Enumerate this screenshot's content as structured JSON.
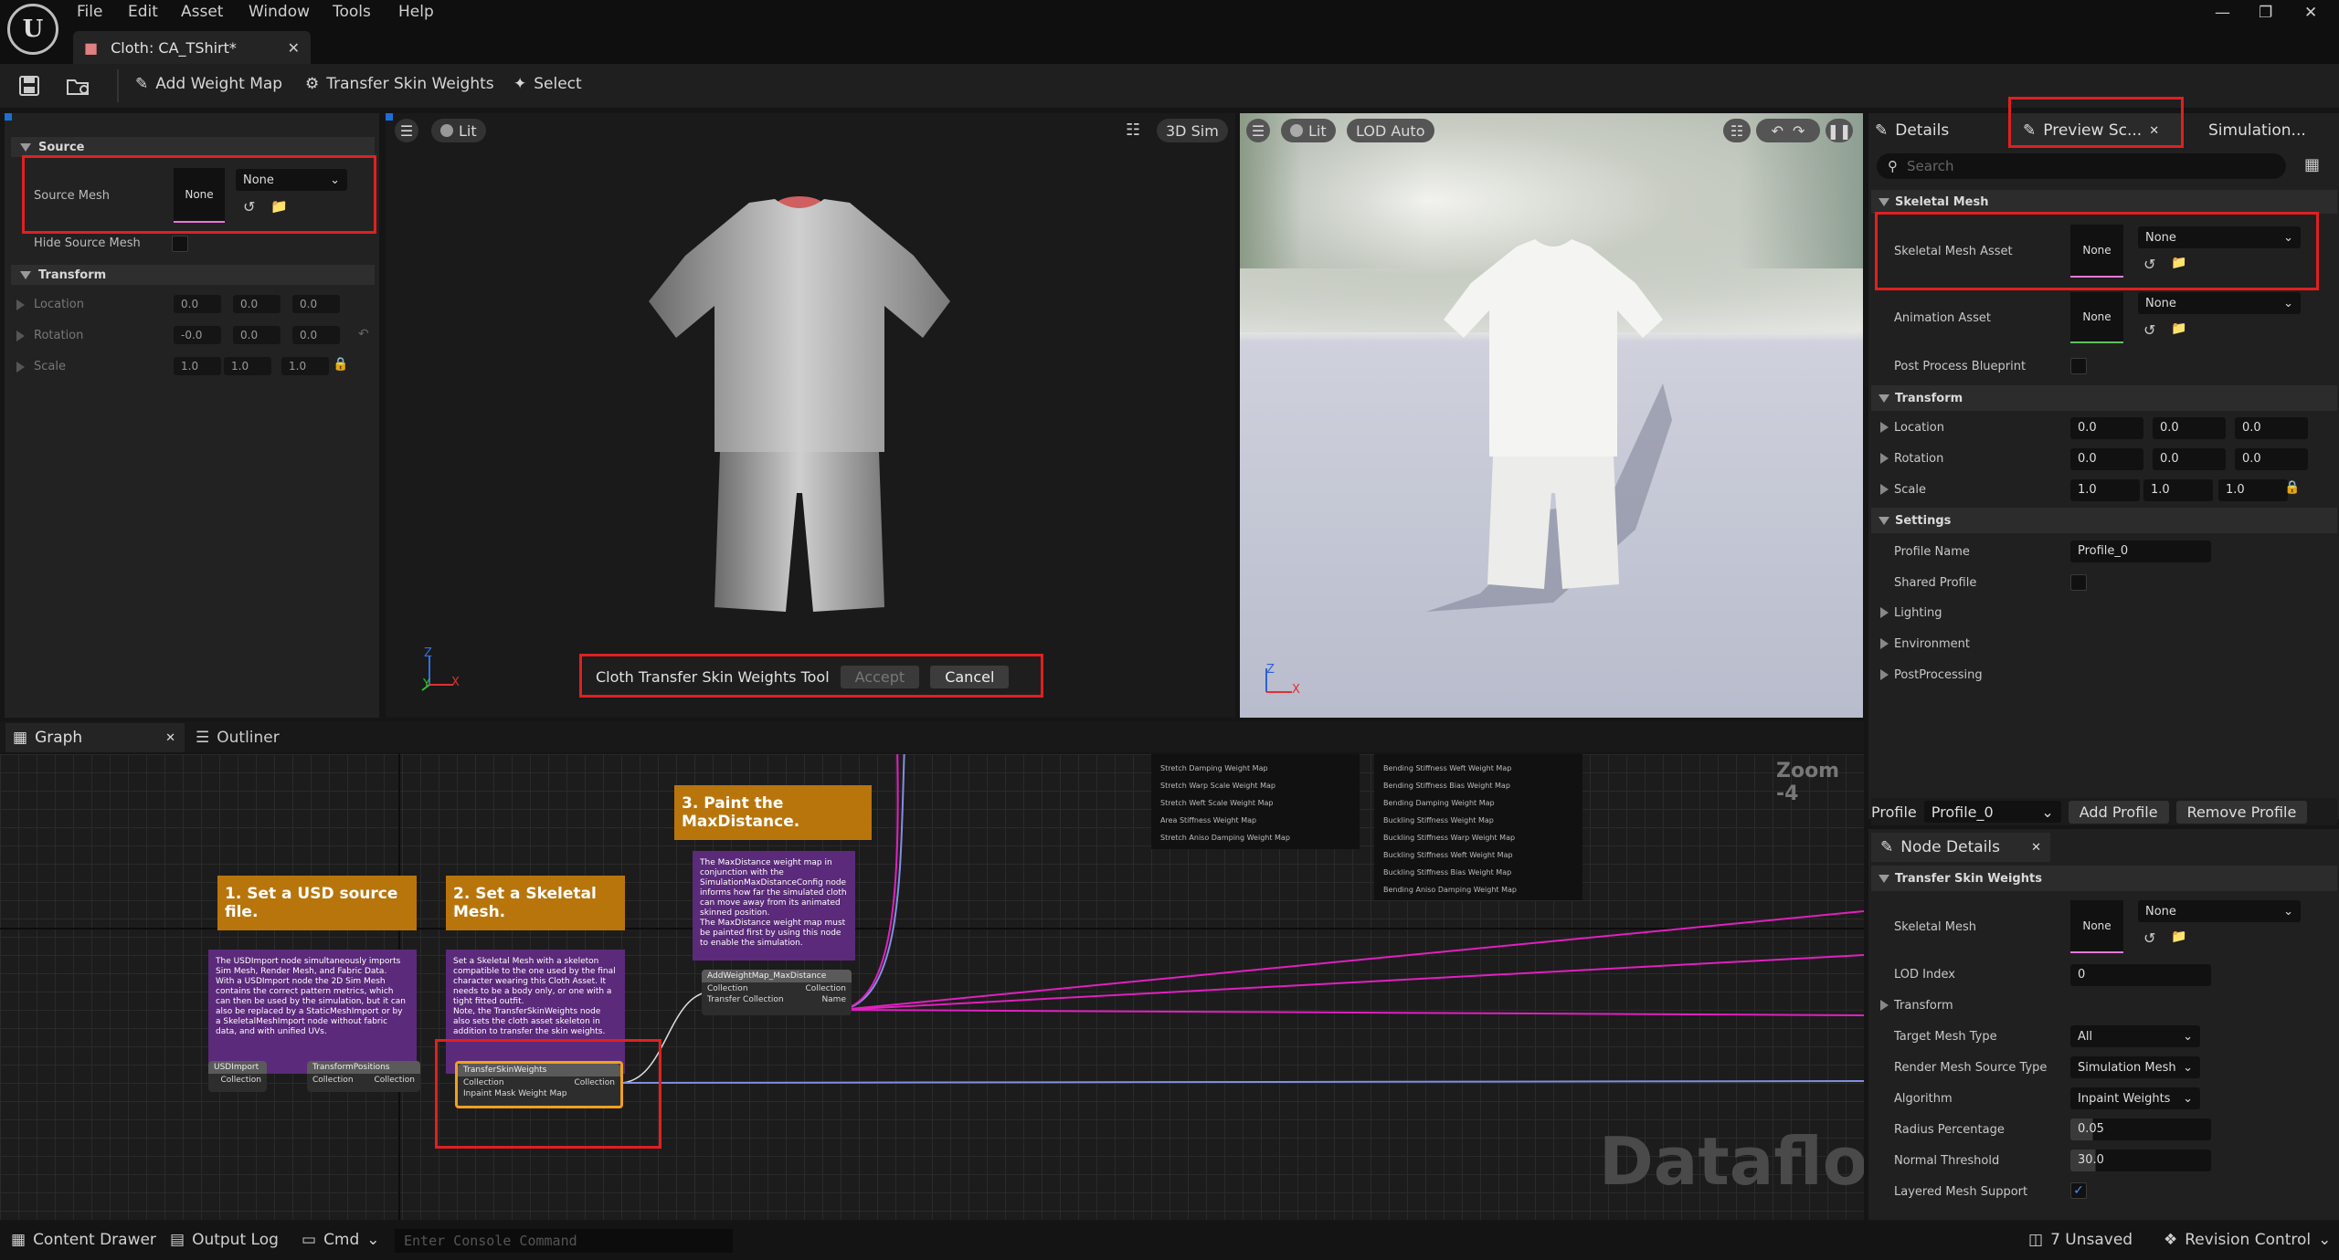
{
  "titlebar": {
    "menus": [
      "File",
      "Edit",
      "Asset",
      "Window",
      "Tools",
      "Help"
    ],
    "tab_label": "Cloth: CA_TShirt*"
  },
  "toolbar": {
    "add_weight_map": "Add Weight Map",
    "transfer_skin_weights": "Transfer Skin Weights",
    "select": "Select"
  },
  "left_panel": {
    "source_section": "Source",
    "source_mesh_label": "Source Mesh",
    "source_mesh_thumb": "None",
    "source_mesh_value": "None",
    "hide_source_mesh": "Hide Source Mesh",
    "transform_section": "Transform",
    "location_label": "Location",
    "location": [
      "0.0",
      "0.0",
      "0.0"
    ],
    "rotation_label": "Rotation",
    "rotation": [
      "-0.0",
      "0.0",
      "0.0"
    ],
    "scale_label": "Scale",
    "scale": [
      "1.0",
      "1.0",
      "1.0"
    ]
  },
  "viewport1": {
    "lit": "Lit",
    "sim": "3D Sim",
    "axis_z": "Z",
    "axis_y": "Y",
    "axis_x": "X",
    "tool_name": "Cloth Transfer Skin Weights Tool",
    "accept": "Accept",
    "cancel": "Cancel"
  },
  "viewport2": {
    "lit": "Lit",
    "lod": "LOD Auto",
    "axis_z": "Z",
    "axis_x": "X"
  },
  "right_panel": {
    "tabs": [
      "Details",
      "Preview Sc...",
      "Simulation..."
    ],
    "search_placeholder": "Search",
    "skeletal_mesh_section": "Skeletal Mesh",
    "skeletal_mesh_asset": "Skeletal Mesh Asset",
    "sk_thumb": "None",
    "sk_value": "None",
    "animation_asset": "Animation Asset",
    "anim_thumb": "None",
    "anim_value": "None",
    "post_process": "Post Process Blueprint",
    "transform_section": "Transform",
    "location_label": "Location",
    "location": [
      "0.0",
      "0.0",
      "0.0"
    ],
    "rotation_label": "Rotation",
    "rotation": [
      "0.0",
      "0.0",
      "0.0"
    ],
    "scale_label": "Scale",
    "scale": [
      "1.0",
      "1.0",
      "1.0"
    ],
    "settings_section": "Settings",
    "profile_name_label": "Profile Name",
    "profile_name": "Profile_0",
    "shared_profile": "Shared Profile",
    "lighting": "Lighting",
    "environment": "Environment",
    "postprocessing": "PostProcessing",
    "profile_label": "Profile",
    "profile_value": "Profile_0",
    "add_profile": "Add Profile",
    "remove_profile": "Remove Profile"
  },
  "node_details": {
    "tab": "Node Details",
    "section": "Transfer Skin Weights",
    "skeletal_mesh": "Skeletal Mesh",
    "sm_thumb": "None",
    "sm_value": "None",
    "lod_index_label": "LOD Index",
    "lod_index": "0",
    "transform": "Transform",
    "target_mesh_type_label": "Target Mesh Type",
    "target_mesh_type": "All",
    "render_mesh_source_label": "Render Mesh Source Type",
    "render_mesh_source": "Simulation Mesh",
    "algorithm_label": "Algorithm",
    "algorithm": "Inpaint Weights",
    "radius_label": "Radius Percentage",
    "radius": "0.05",
    "normal_threshold_label": "Normal Threshold",
    "normal_threshold": "30.0",
    "layered_label": "Layered Mesh Support"
  },
  "graph": {
    "tab_graph": "Graph",
    "tab_outliner": "Outliner",
    "zoom": "Zoom -4",
    "watermark": "Dataflow",
    "comment1": "1. Set a USD source file.",
    "comment2": "2. Set a Skeletal Mesh.",
    "comment3": "3. Paint the MaxDistance.",
    "note1": "The USDImport node simultaneously imports Sim Mesh, Render Mesh, and Fabric Data.\nWith a USDImport node the 2D Sim Mesh contains the correct pattern metrics, which can then be used by the simulation, but it can also be replaced by a StaticMeshImport or by a SkeletalMeshImport node without fabric data, and with unified UVs.",
    "note2": "Set a Skeletal Mesh with a skeleton compatible to the one used by the final character wearing this Cloth Asset. It needs to be a body only, or one with a tight fitted outfit.\nNote, the TransferSkinWeights node also sets the cloth asset skeleton in addition to transfer the skin weights.",
    "note3": "The MaxDistance weight map in conjunction with the SimulationMaxDistanceConfig node informs how far the simulated cloth can move away from its animated skinned position.\nThe MaxDistance weight map must be painted first by using this node to enable the simulation.",
    "node_usd": "USDImport",
    "node_transform": "TransformPositions",
    "node_transfer": "TransferSkinWeights",
    "node_addweight": "AddWeightMap_MaxDistance",
    "pin_collection": "Collection",
    "pin_inpaint": "Inpaint Mask Weight Map",
    "pin_transfer_collection": "Transfer Collection",
    "pin_name": "Name",
    "list1": [
      "Stretch Damping Weight Map",
      "Stretch Warp Scale Weight Map",
      "Stretch Weft Scale Weight Map",
      "Area Stiffness Weight Map",
      "Stretch Aniso Damping Weight Map"
    ],
    "list2": [
      "Bending Stiffness Weft Weight Map",
      "Bending Stiffness Bias Weight Map",
      "Bending Damping Weight Map",
      "Buckling Stiffness Weight Map",
      "Buckling Stiffness Warp Weight Map",
      "Buckling Stiffness Weft Weight Map",
      "Buckling Stiffness Bias Weight Map",
      "Bending Aniso Damping Weight Map"
    ]
  },
  "statusbar": {
    "content_drawer": "Content Drawer",
    "output_log": "Output Log",
    "cmd": "Cmd",
    "console_placeholder": "Enter Console Command",
    "unsaved": "7 Unsaved",
    "revision": "Revision Control"
  },
  "colors": {
    "highlight": "#e02020",
    "comment": "#b8750c",
    "note": "#5b2a7a",
    "wire_pink": "#e020c0",
    "wire_blue": "#8090e0",
    "selection": "#f0a020"
  }
}
